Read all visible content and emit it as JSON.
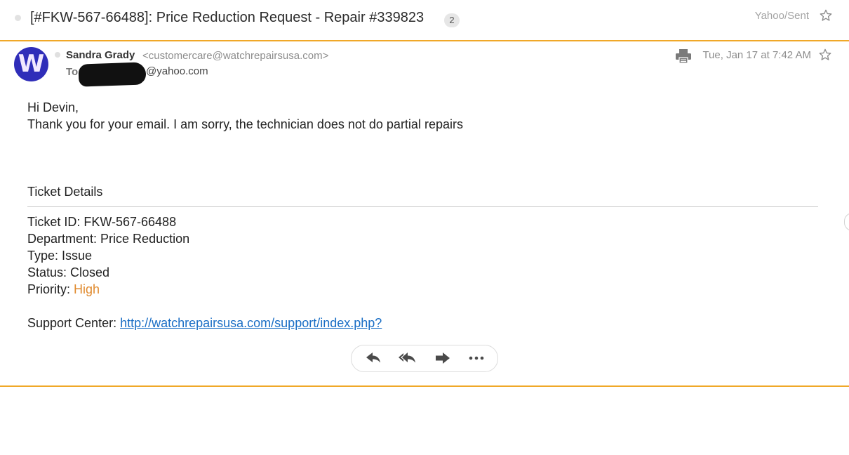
{
  "thread": {
    "subject": "[#FKW-567-66488]: Price Reduction Request - Repair #339823",
    "count": "2",
    "folder": "Yahoo/Sent"
  },
  "message": {
    "avatar_letter": "W",
    "sender_name": "Sandra Grady",
    "sender_email": "<customercare@watchrepairsusa.com>",
    "to_label": "To:",
    "to_email_visible": "@yahoo.com",
    "date": "Tue, Jan 17 at 7:42 AM",
    "body": {
      "greeting": "Hi Devin,",
      "line1": "Thank you for your email. I am sorry, the technician does not do partial repairs",
      "details_heading": "Ticket Details",
      "ticket_id": "Ticket ID: FKW-567-66488",
      "department": "Department: Price Reduction",
      "type": "Type: Issue",
      "status": "Status: Closed",
      "priority_label": "Priority: ",
      "priority_value": "High",
      "support_label": "Support Center: ",
      "support_link": "http://watchrepairsusa.com/support/index.php?"
    }
  },
  "actions": [
    "reply",
    "reply-all",
    "forward",
    "more"
  ],
  "colors": {
    "accent": "#f0a828",
    "priority_high": "#e08a2e",
    "link": "#1a6ec5",
    "avatar_bg": "#2f2db9"
  }
}
